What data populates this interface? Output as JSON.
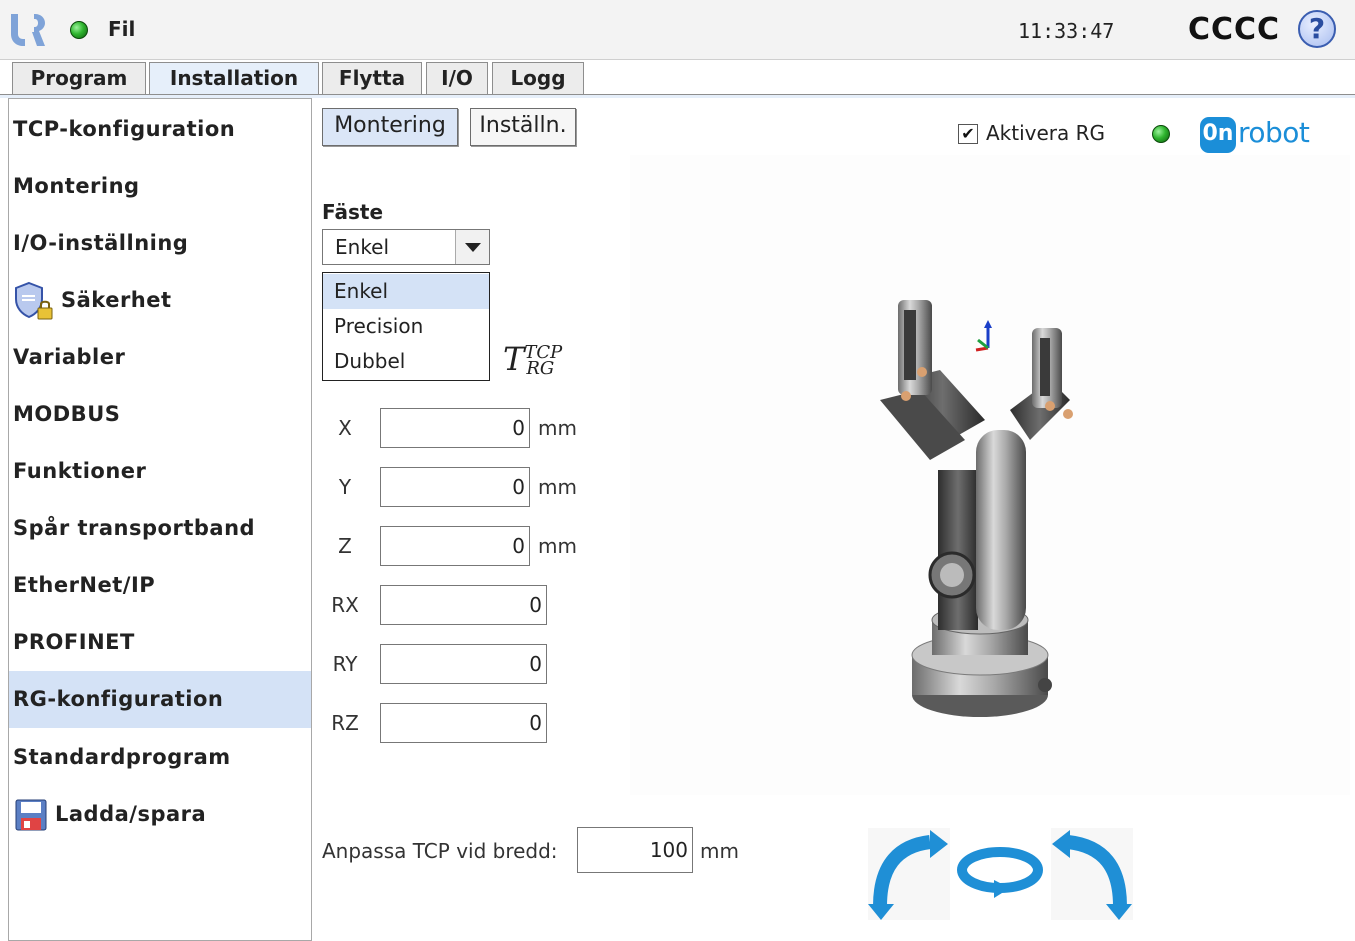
{
  "topbar": {
    "file_menu": "Fil",
    "clock": "11:33:47",
    "robot_name": "CCCC",
    "help_glyph": "?"
  },
  "tabs": {
    "program": "Program",
    "installation": "Installation",
    "flytta": "Flytta",
    "io": "I/O",
    "logg": "Logg",
    "active": "Installation"
  },
  "sidebar": {
    "items": [
      {
        "label": "TCP-konfiguration"
      },
      {
        "label": "Montering"
      },
      {
        "label": "I/O-inställning"
      },
      {
        "label": "Säkerhet",
        "icon": "security-shield-icon"
      },
      {
        "label": "Variabler"
      },
      {
        "label": "MODBUS"
      },
      {
        "label": "Funktioner"
      },
      {
        "label": "Spår transportband"
      },
      {
        "label": "EtherNet/IP"
      },
      {
        "label": "PROFINET"
      },
      {
        "label": "RG-konfiguration",
        "selected": true
      },
      {
        "label": "Standardprogram"
      },
      {
        "label": "Ladda/spara",
        "icon": "save-disk-icon"
      }
    ]
  },
  "main": {
    "buttons": {
      "montering": "Montering",
      "installn": "Inställn."
    },
    "aktivera": {
      "label": "Aktivera RG",
      "checked": true
    },
    "onrobot_logo": {
      "mark": "0n",
      "text": "robot"
    },
    "faste": {
      "label": "Fäste",
      "selected": "Enkel",
      "options": [
        "Enkel",
        "Precision",
        "Dubbel"
      ]
    },
    "formula": {
      "base": "T",
      "sup": "TCP",
      "sub": "RG"
    },
    "coords": {
      "x": {
        "label": "X",
        "value": "0",
        "unit": "mm"
      },
      "y": {
        "label": "Y",
        "value": "0",
        "unit": "mm"
      },
      "z": {
        "label": "Z",
        "value": "0",
        "unit": "mm"
      },
      "rx": {
        "label": "RX",
        "value": "0"
      },
      "ry": {
        "label": "RY",
        "value": "0"
      },
      "rz": {
        "label": "RZ",
        "value": "0"
      }
    },
    "anpassa": {
      "label": "Anpassa TCP vid bredd:",
      "value": "100",
      "unit": "mm"
    }
  },
  "colors": {
    "accent_blue": "#1b8ed8",
    "selection": "#d4e2f6",
    "status_green": "#2fb52f",
    "rotate_arrow": "#1f8fd6"
  }
}
